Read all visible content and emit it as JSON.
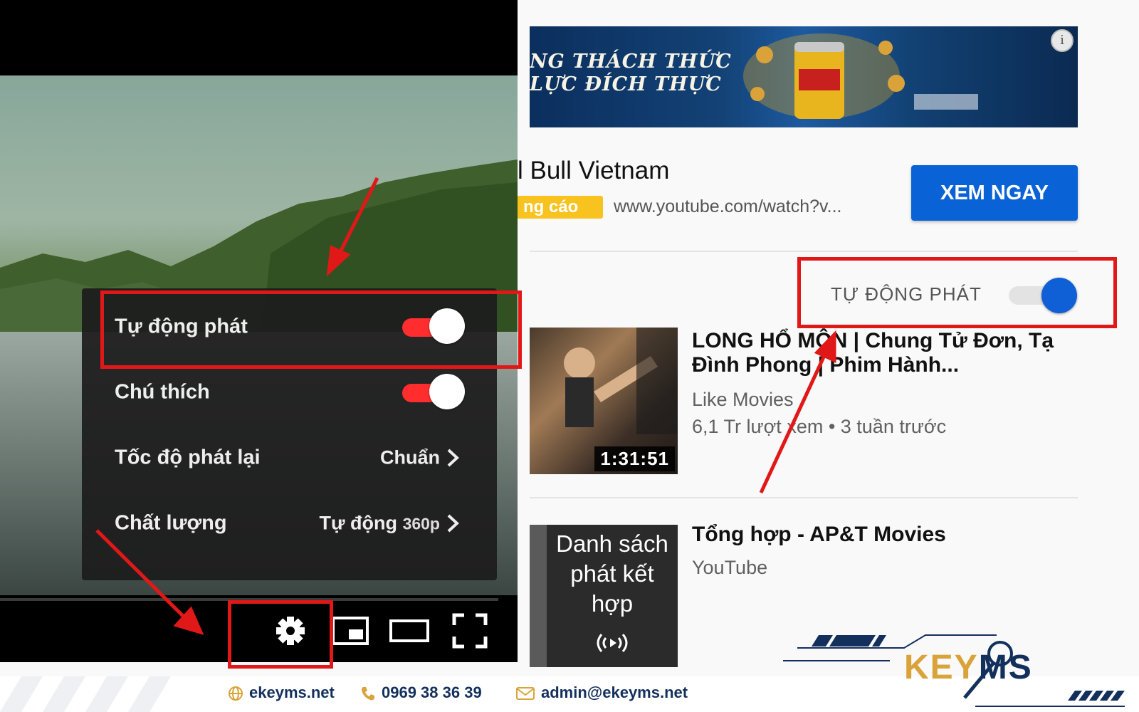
{
  "player": {
    "menu": {
      "autoplay_label": "Tự động phát",
      "captions_label": "Chú thích",
      "speed_label": "Tốc độ phát lại",
      "speed_value": "Chuẩn",
      "quality_label": "Chất lượng",
      "quality_value": "Tự động",
      "quality_suffix": "360p",
      "autoplay_on": true,
      "captions_on": true
    },
    "controls": [
      "settings-icon",
      "miniplayer-icon",
      "theater-mode-icon",
      "fullscreen-icon"
    ]
  },
  "sidebar": {
    "ad": {
      "tagline_line1": "NG THÁCH THỨC",
      "tagline_line2": "LỰC ĐÍCH THỰC",
      "info_icon": "i",
      "title": "l Bull Vietnam",
      "badge": "ng cáo",
      "url": "www.youtube.com/watch?v...",
      "cta": "XEM NGAY"
    },
    "autoplay": {
      "label": "TỰ ĐỘNG PHÁT",
      "on": true
    },
    "videos": [
      {
        "title": "LONG HỔ MÔN | Chung Tử Đơn, Tạ Đình Phong | Phim Hành...",
        "channel": "Like Movies",
        "meta": "6,1 Tr lượt xem • 3 tuần trước",
        "duration": "1:31:51"
      },
      {
        "title": "Tổng hợp - AP&T Movies",
        "channel": "YouTube",
        "overlay_text": "Danh sách phát kết hợp"
      }
    ]
  },
  "footer": {
    "website": "ekeyms.net",
    "phone": "0969 38 36 39",
    "email": "admin@ekeyms.net"
  },
  "brand": {
    "part1": "KEY",
    "part2": "MS"
  },
  "colors": {
    "youtube_red": "#ff2d2d",
    "cta_blue": "#0a63d6",
    "annotation_red": "#e11818",
    "brand_navy": "#13305c",
    "brand_gold": "#d9a33a"
  }
}
